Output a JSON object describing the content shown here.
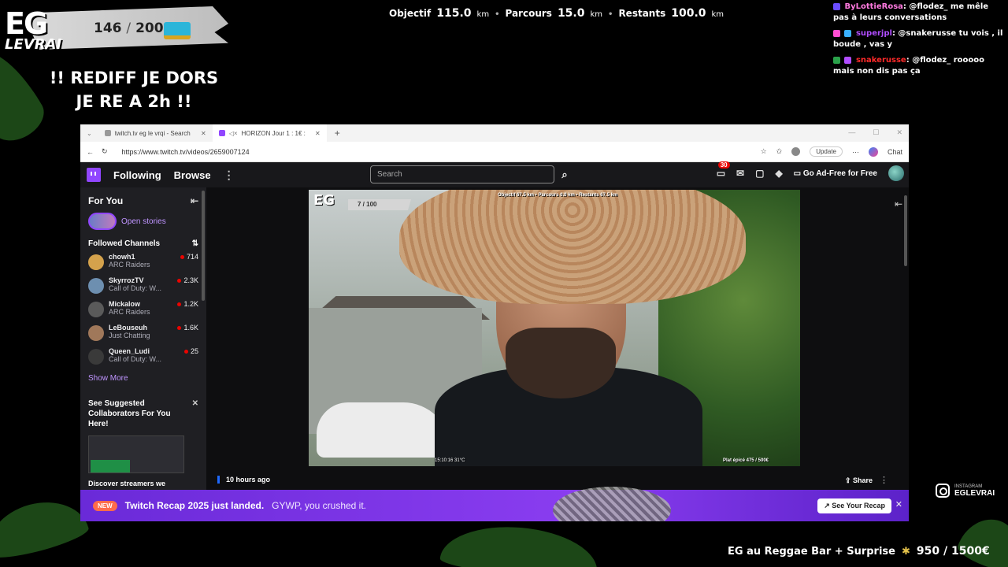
{
  "overlay": {
    "logo_main": "EG",
    "logo_sub": "LEVRAI",
    "sub_count": "146",
    "sub_goal": "200",
    "rediff_line1": "!! REDIFF JE DORS",
    "rediff_line2": "JE RE A 2h !!",
    "stats": {
      "objectif_label": "Objectif",
      "objectif_value": "115.0",
      "parcours_label": "Parcours",
      "parcours_value": "15.0",
      "restants_label": "Restants",
      "restants_value": "100.0",
      "unit": "km",
      "separator": "•"
    },
    "instagram_label": "INSTAGRAM",
    "instagram_handle": "EGLEVRAI",
    "goal_text": "EG au Reggae Bar + Surprise",
    "goal_amount": "950 / 1500€"
  },
  "chat": [
    {
      "name": "ByLottieRosa",
      "name_color": "#ff7ae0",
      "text": "@flodez_ me mêle pas à leurs conversations"
    },
    {
      "name": "superjpl",
      "name_color": "#b04dff",
      "text": "@snakerusse tu vois , il boude , vas y"
    },
    {
      "name": "snakerusse",
      "name_color": "#ff2a2a",
      "text": "@flodez_ rooooo mais non dis pas ça"
    }
  ],
  "browser": {
    "tabs": [
      {
        "label": "twitch.tv eg le vrqi - Search"
      },
      {
        "label": "HORIZON Jour 1 : 1€ :"
      }
    ],
    "new_tab": "+",
    "url": "https://www.twitch.tv/videos/2659007124",
    "update_label": "Update",
    "chat_label": "Chat"
  },
  "twitch": {
    "nav": {
      "following": "Following",
      "browse": "Browse",
      "search_placeholder": "Search",
      "notif_count": "30",
      "adfree": "Go Ad-Free for Free"
    },
    "sidebar": {
      "for_you": "For You",
      "open_stories": "Open stories",
      "followed_channels": "Followed Channels",
      "channels": [
        {
          "name": "chowh1",
          "game": "ARC Raiders",
          "viewers": "714",
          "color": "#d4a24c"
        },
        {
          "name": "SkyrrozTV",
          "game": "Call of Duty: W...",
          "viewers": "2.3K",
          "color": "#6d8fb0"
        },
        {
          "name": "Mickalow",
          "game": "ARC Raiders",
          "viewers": "1.2K",
          "color": "#5a5a5a"
        },
        {
          "name": "LeBouseuh",
          "game": "Just Chatting",
          "viewers": "1.6K",
          "color": "#a0785a"
        },
        {
          "name": "Queen_Ludi",
          "game": "Call of Duty: W...",
          "viewers": "25",
          "color": "#3a3a3a"
        }
      ],
      "show_more": "Show More",
      "suggest_title": "See Suggested Collaborators For You Here!",
      "discover": "Discover streamers we"
    },
    "video": {
      "overlay_logo": "EG",
      "overlay_count": "7 / 100",
      "overlay_stats": "Objectif 67.5 km • Parcours 0.0 km • Restants 67.5 km",
      "overlay_bottom": "Plat épicé 475 / 500€",
      "overlay_clock": "15:10:16 31°C"
    },
    "time_ago": "10 hours ago",
    "share": "Share",
    "recap": {
      "pill": "NEW",
      "title": "Twitch Recap 2025 just landed.",
      "sub": "GYWP, you crushed it.",
      "button": "See Your Recap"
    }
  }
}
